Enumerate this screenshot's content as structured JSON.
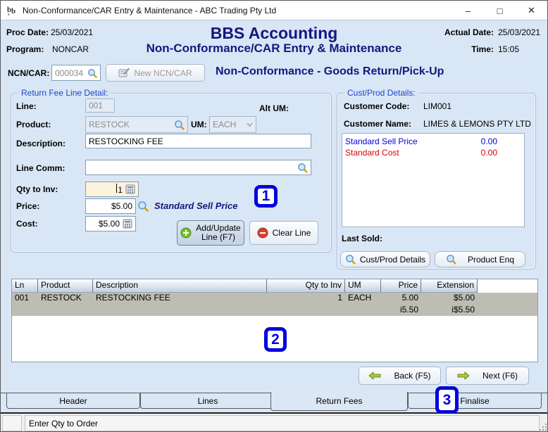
{
  "window": {
    "title": "Non-Conformance/CAR Entry & Maintenance - ABC Trading Pty Ltd"
  },
  "header": {
    "proc_date_label": "Proc Date:",
    "proc_date": "25/03/2021",
    "program_label": "Program:",
    "program": "NONCAR",
    "app_title": "BBS Accounting",
    "screen_title": "Non-Conformance/CAR Entry & Maintenance",
    "actual_date_label": "Actual Date:",
    "actual_date": "25/03/2021",
    "time_label": "Time:",
    "time": "15:05"
  },
  "ncn_bar": {
    "label": "NCN/CAR:",
    "value": "000034",
    "new_button": "New NCN/CAR",
    "heading": "Non-Conformance - Goods Return/Pick-Up"
  },
  "return_fee_panel": {
    "title": "Return Fee Line Detail:",
    "line_label": "Line:",
    "line_value": "001",
    "alt_um_label": "Alt UM:",
    "product_label": "Product:",
    "product_value": "RESTOCK",
    "um_label": "UM:",
    "um_value": "EACH",
    "description_label": "Description:",
    "description_value": "RESTOCKING FEE",
    "line_comm_label": "Line Comm:",
    "line_comm_value": "",
    "qty_label": "Qty to Inv:",
    "qty_value": "1",
    "price_label": "Price:",
    "price_value": "$5.00",
    "price_note": "Standard Sell Price",
    "cost_label": "Cost:",
    "cost_value": "$5.00",
    "add_update_line1": "Add/Update",
    "add_update_line2": "Line (F7)",
    "clear_button": "Clear Line"
  },
  "cust_prod_panel": {
    "title": "Cust/Prod Details:",
    "customer_code_label": "Customer Code:",
    "customer_code": "LIM001",
    "customer_name_label": "Customer Name:",
    "customer_name": "LIMES & LEMONS PTY LTD",
    "price_list": [
      {
        "label": "Standard Sell Price",
        "value": "0.00",
        "color": "#0000e0"
      },
      {
        "label": "Standard Cost",
        "value": "0.00",
        "color": "#dd0000"
      }
    ],
    "last_sold_label": "Last Sold:",
    "cust_prod_button": "Cust/Prod Details",
    "product_enq_button": "Product Enq"
  },
  "lines_table": {
    "columns": [
      "Ln",
      "Product",
      "Description",
      "Qty to Inv",
      "UM",
      "Price",
      "Extension"
    ],
    "rows": [
      {
        "cells": [
          "001",
          "RESTOCK",
          "RESTOCKING FEE",
          "1",
          "EACH",
          "5.00",
          "$5.00"
        ]
      },
      {
        "cells": [
          "",
          "",
          "",
          "",
          "",
          "i5.50",
          "i$5.50"
        ]
      }
    ]
  },
  "nav": {
    "back_button": "Back (F5)",
    "next_button": "Next (F6)"
  },
  "tabs": [
    {
      "label": "Header",
      "active": false
    },
    {
      "label": "Lines",
      "active": false
    },
    {
      "label": "Return Fees",
      "active": true
    },
    {
      "label": "Finalise",
      "active": false
    }
  ],
  "status_bar": {
    "message": "Enter Qty to Order"
  },
  "annotations": [
    "1",
    "2",
    "3"
  ],
  "colors": {
    "accent_navy": "#16167e",
    "group_label_blue": "#2145cc",
    "annotation_blue": "#0202dd",
    "selected_row": "#bebdb5",
    "qty_field_cream": "#fdf3da",
    "std_sell_blue": "#0000e0",
    "std_cost_red": "#dd0000",
    "background": "#d9e6f5"
  }
}
